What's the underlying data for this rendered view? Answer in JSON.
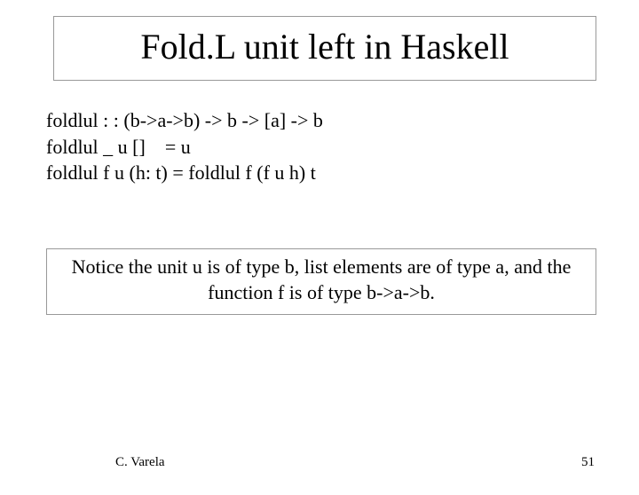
{
  "title": "Fold.L unit left in Haskell",
  "code": {
    "line1": "foldlul : : (b->a->b) -> b -> [a] -> b",
    "line2": "foldlul _ u []    = u",
    "line3": "foldlul f u (h: t) = foldlul f (f u h) t"
  },
  "notice": "Notice the unit u is of type b, list elements are of type a, and the function f is of type b->a->b.",
  "footer": {
    "author": "C. Varela",
    "page": "51"
  }
}
